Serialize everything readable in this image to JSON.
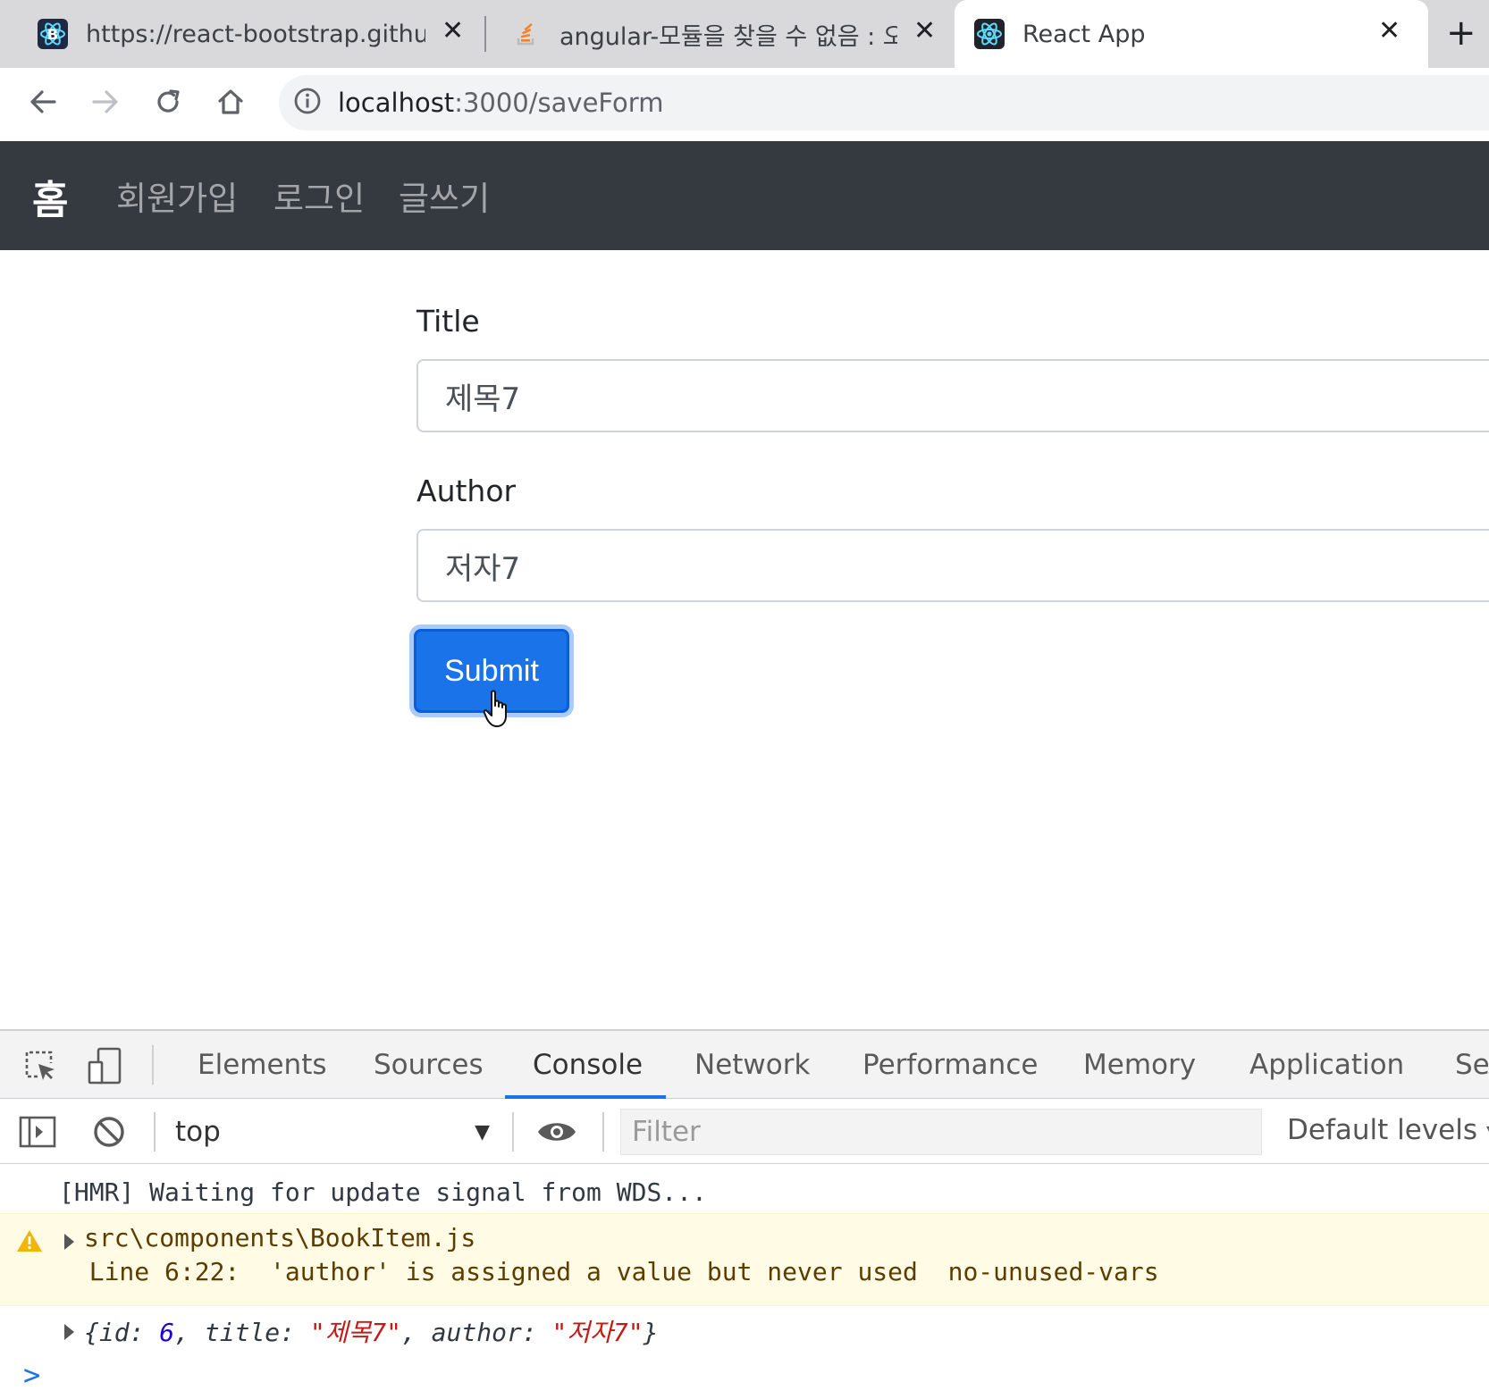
{
  "browser": {
    "tabs": [
      {
        "title": "https://react-bootstrap.github.io",
        "favicon": "react-bootstrap-icon"
      },
      {
        "title": "angular-모듈을 찾을 수 없음 : 오",
        "favicon": "stackoverflow-icon"
      },
      {
        "title": "React App",
        "favicon": "react-icon",
        "active": true
      }
    ],
    "new_tab_label": "+",
    "address": {
      "host": "localhost",
      "path": ":3000/saveForm"
    }
  },
  "navbar": {
    "brand": "홈",
    "links": [
      "회원가입",
      "로그인",
      "글쓰기"
    ]
  },
  "form": {
    "title_label": "Title",
    "title_value": "제목7",
    "author_label": "Author",
    "author_value": "저자7",
    "submit_label": "Submit"
  },
  "devtools": {
    "tabs": [
      "Elements",
      "Sources",
      "Console",
      "Network",
      "Performance",
      "Memory",
      "Application",
      "Se"
    ],
    "active_tab": "Console",
    "context": "top",
    "filter_placeholder": "Filter",
    "levels": "Default levels",
    "logs": {
      "hmr": "[HMR] Waiting for update signal from WDS...",
      "warning_file": "src\\components\\BookItem.js",
      "warning_msg": "  Line 6:22:  'author' is assigned a value but never used  no-unused-vars",
      "obj_prefix": "{id: ",
      "obj_id": "6",
      "obj_mid": ", title: ",
      "obj_title": "\"제목7\"",
      "obj_mid2": ", author: ",
      "obj_author": "\"저자7\"",
      "obj_suffix": "}"
    },
    "prompt": ">"
  },
  "colors": {
    "navbar_bg": "#343a40",
    "primary": "#1a73e8",
    "warning_bg": "#fffbe5"
  }
}
